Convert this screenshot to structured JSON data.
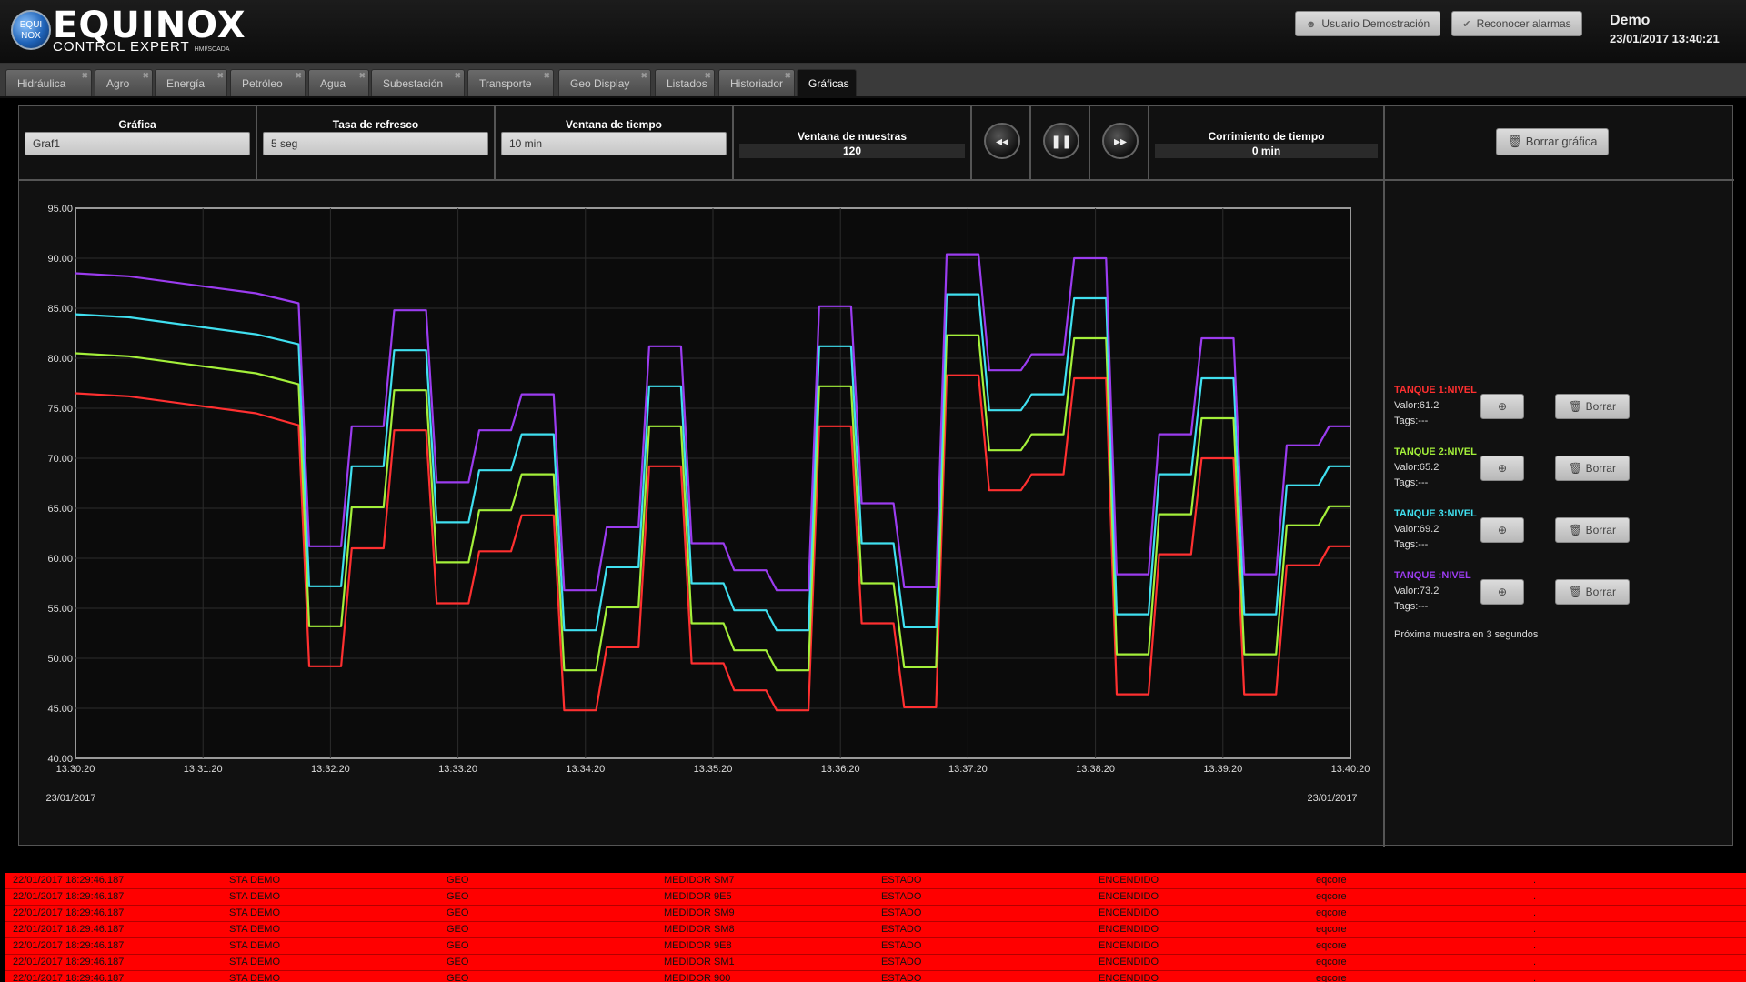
{
  "header": {
    "logo_badge_top": "EQUI",
    "logo_badge_bottom": "NOX",
    "logo_title": "EQUINOX",
    "logo_subtitle": "CONTROL EXPERT",
    "logo_suffix": "HMI/SCADA",
    "user_button": "Usuario Demostración",
    "ack_button": "Reconocer alarmas",
    "user_name": "Demo",
    "datetime": "23/01/2017 13:40:21",
    "user_icon": "user-icon",
    "ack_icon": "check-icon"
  },
  "tabs": [
    {
      "label": "Hidráulica",
      "active": false
    },
    {
      "label": "Agro",
      "active": false
    },
    {
      "label": "Energía",
      "active": false
    },
    {
      "label": "Petróleo",
      "active": false
    },
    {
      "label": "Agua",
      "active": false
    },
    {
      "label": "Subestación",
      "active": false
    },
    {
      "label": "Transporte",
      "active": false
    },
    {
      "label": "Geo Display",
      "active": false
    },
    {
      "label": "Listados",
      "active": false
    },
    {
      "label": "Historiador",
      "active": false
    },
    {
      "label": "Gráficas",
      "active": true
    }
  ],
  "controls": {
    "grafica_label": "Gráfica",
    "grafica_value": "Graf1",
    "refresh_label": "Tasa de refresco",
    "refresh_value": "5 seg",
    "window_label": "Ventana de tiempo",
    "window_value": "10 min",
    "samples_label": "Ventana de muestras",
    "samples_value": "120",
    "rewind_icon": "◂◂",
    "pause_icon": "❚❚",
    "forward_icon": "▸▸",
    "shift_label": "Corrimiento de tiempo",
    "shift_value": "0 min",
    "clear_graph": "Borrar gráfica"
  },
  "chart_data": {
    "type": "line",
    "x": [
      "13:30:20",
      "13:30:45",
      "13:31:20",
      "13:31:45",
      "13:32:05",
      "13:32:10",
      "13:32:25",
      "13:32:30",
      "13:32:45",
      "13:32:50",
      "13:33:05",
      "13:33:10",
      "13:33:25",
      "13:33:30",
      "13:33:45",
      "13:33:50",
      "13:34:05",
      "13:34:10",
      "13:34:25",
      "13:34:30",
      "13:34:45",
      "13:34:50",
      "13:35:05",
      "13:35:10",
      "13:35:25",
      "13:35:30",
      "13:35:45",
      "13:35:50",
      "13:36:05",
      "13:36:10",
      "13:36:25",
      "13:36:30",
      "13:36:45",
      "13:36:50",
      "13:37:05",
      "13:37:10",
      "13:37:25",
      "13:37:30",
      "13:37:45",
      "13:37:50",
      "13:38:05",
      "13:38:10",
      "13:38:25",
      "13:38:30",
      "13:38:45",
      "13:38:50",
      "13:39:05",
      "13:39:10",
      "13:39:25",
      "13:39:30",
      "13:39:45",
      "13:39:50",
      "13:40:05",
      "13:40:10",
      "13:40:20"
    ],
    "xticks": [
      "13:30:20",
      "13:31:20",
      "13:32:20",
      "13:33:20",
      "13:34:20",
      "13:35:20",
      "13:36:20",
      "13:37:20",
      "13:38:20",
      "13:39:20",
      "13:40:20"
    ],
    "date_left": "23/01/2017",
    "date_right": "23/01/2017",
    "ylim": [
      40,
      95
    ],
    "yticks": [
      "40.00",
      "45.00",
      "50.00",
      "55.00",
      "60.00",
      "65.00",
      "70.00",
      "75.00",
      "80.00",
      "85.00",
      "90.00",
      "95.00"
    ],
    "grid": true,
    "series": [
      {
        "name": "TANQUE 1:NIVEL",
        "color": "#ff3030",
        "values": [
          76.5,
          76.2,
          75.2,
          74.5,
          73.3,
          49.2,
          49.2,
          61.0,
          61.0,
          72.8,
          72.8,
          55.5,
          55.5,
          60.7,
          60.7,
          64.3,
          64.3,
          44.8,
          44.8,
          51.1,
          51.1,
          69.2,
          69.2,
          49.5,
          49.5,
          46.8,
          46.8,
          44.8,
          44.8,
          73.2,
          73.2,
          53.5,
          53.5,
          45.1,
          45.1,
          78.3,
          78.3,
          66.8,
          66.8,
          68.4,
          68.4,
          78.0,
          78.0,
          46.4,
          46.4,
          60.4,
          60.4,
          70.0,
          70.0,
          46.4,
          46.4,
          59.3,
          59.3,
          61.2,
          61.2
        ]
      },
      {
        "name": "TANQUE 2:NIVEL",
        "color": "#a4f03a",
        "values": [
          80.5,
          80.2,
          79.2,
          78.5,
          77.4,
          53.2,
          53.2,
          65.1,
          65.1,
          76.8,
          76.8,
          59.6,
          59.6,
          64.8,
          64.8,
          68.4,
          68.4,
          48.8,
          48.8,
          55.1,
          55.1,
          73.2,
          73.2,
          53.5,
          53.5,
          50.8,
          50.8,
          48.8,
          48.8,
          77.2,
          77.2,
          57.5,
          57.5,
          49.1,
          49.1,
          82.3,
          82.3,
          70.8,
          70.8,
          72.4,
          72.4,
          82.0,
          82.0,
          50.4,
          50.4,
          64.4,
          64.4,
          74.0,
          74.0,
          50.4,
          50.4,
          63.3,
          63.3,
          65.2,
          65.2
        ]
      },
      {
        "name": "TANQUE 3:NIVEL",
        "color": "#40e0f0",
        "values": [
          84.4,
          84.1,
          83.1,
          82.4,
          81.4,
          57.2,
          57.2,
          69.2,
          69.2,
          80.8,
          80.8,
          63.6,
          63.6,
          68.8,
          68.8,
          72.4,
          72.4,
          52.8,
          52.8,
          59.1,
          59.1,
          77.2,
          77.2,
          57.5,
          57.5,
          54.8,
          54.8,
          52.8,
          52.8,
          81.2,
          81.2,
          61.5,
          61.5,
          53.1,
          53.1,
          86.4,
          86.4,
          74.8,
          74.8,
          76.4,
          76.4,
          86.0,
          86.0,
          54.4,
          54.4,
          68.4,
          68.4,
          78.0,
          78.0,
          54.4,
          54.4,
          67.3,
          67.3,
          69.2,
          69.2
        ]
      },
      {
        "name": "TANQUE :NIVEL",
        "color": "#9b3cf0",
        "values": [
          88.5,
          88.2,
          87.2,
          86.5,
          85.5,
          61.2,
          61.2,
          73.2,
          73.2,
          84.8,
          84.8,
          67.6,
          67.6,
          72.8,
          72.8,
          76.4,
          76.4,
          56.8,
          56.8,
          63.1,
          63.1,
          81.2,
          81.2,
          61.5,
          61.5,
          58.8,
          58.8,
          56.8,
          56.8,
          85.2,
          85.2,
          65.5,
          65.5,
          57.1,
          57.1,
          90.4,
          90.4,
          78.8,
          78.8,
          80.4,
          80.4,
          90.0,
          90.0,
          58.4,
          58.4,
          72.4,
          72.4,
          82.0,
          82.0,
          58.4,
          58.4,
          71.3,
          71.3,
          73.2,
          73.2
        ]
      }
    ]
  },
  "legend": [
    {
      "name": "TANQUE 1:NIVEL",
      "color": "#ff3030",
      "valor": "Valor:61.2",
      "tags": "Tags:---",
      "delete": "Borrar"
    },
    {
      "name": "TANQUE 2:NIVEL",
      "color": "#a4f03a",
      "valor": "Valor:65.2",
      "tags": "Tags:---",
      "delete": "Borrar"
    },
    {
      "name": "TANQUE 3:NIVEL",
      "color": "#40e0f0",
      "valor": "Valor:69.2",
      "tags": "Tags:---",
      "delete": "Borrar"
    },
    {
      "name": "TANQUE :NIVEL",
      "color": "#9b3cf0",
      "valor": "Valor:73.2",
      "tags": "Tags:---",
      "delete": "Borrar"
    }
  ],
  "next_sample": "Próxima muestra en 3 segundos",
  "alarms": [
    [
      "22/01/2017 18:29:46.187",
      "STA DEMO",
      "GEO",
      "MEDIDOR SM7",
      "ESTADO",
      "ENCENDIDO",
      "eqcore",
      "."
    ],
    [
      "22/01/2017 18:29:46.187",
      "STA DEMO",
      "GEO",
      "MEDIDOR 9E5",
      "ESTADO",
      "ENCENDIDO",
      "eqcore",
      "."
    ],
    [
      "22/01/2017 18:29:46.187",
      "STA DEMO",
      "GEO",
      "MEDIDOR SM9",
      "ESTADO",
      "ENCENDIDO",
      "eqcore",
      "."
    ],
    [
      "22/01/2017 18:29:46.187",
      "STA DEMO",
      "GEO",
      "MEDIDOR SM8",
      "ESTADO",
      "ENCENDIDO",
      "eqcore",
      "."
    ],
    [
      "22/01/2017 18:29:46.187",
      "STA DEMO",
      "GEO",
      "MEDIDOR 9E8",
      "ESTADO",
      "ENCENDIDO",
      "eqcore",
      "."
    ],
    [
      "22/01/2017 18:29:46.187",
      "STA DEMO",
      "GEO",
      "MEDIDOR SM1",
      "ESTADO",
      "ENCENDIDO",
      "eqcore",
      "."
    ],
    [
      "22/01/2017 18:29:46.187",
      "STA DEMO",
      "GEO",
      "MEDIDOR 900",
      "ESTADO",
      "ENCENDIDO",
      "eqcore",
      "."
    ]
  ]
}
